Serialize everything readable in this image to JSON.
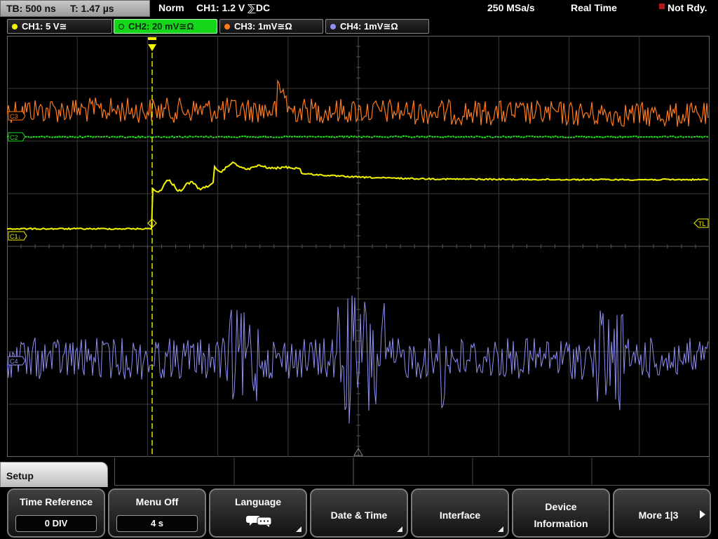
{
  "topbar": {
    "timebase": "TB: 500 ns",
    "trigger_time": "T: 1.47 µs",
    "trigger_mode": "Norm",
    "trigger_source": "CH1: 1.2 V ⅀DC",
    "sample_rate": "250 MSa/s",
    "acquisition": "Real Time",
    "status": "Not Rdy.",
    "status_color": "#b11a1a"
  },
  "channels": [
    {
      "label": "CH1: 5 V≅",
      "color": "#f4f400",
      "marker": "C1↓"
    },
    {
      "label": "CH2: 20 mV≅Ω",
      "color": "#22dd22",
      "marker": "C2"
    },
    {
      "label": "CH3: 1mV≅Ω",
      "color": "#ff7a1a",
      "marker": "C3"
    },
    {
      "label": "CH4: 1mV≅Ω",
      "color": "#8f8ff2",
      "marker": "C4"
    }
  ],
  "display": {
    "trigger_level_marker": "TL",
    "grid_color": "#3a3a3a"
  },
  "menu": {
    "title": "Setup",
    "softkeys": [
      {
        "label": "Time Reference",
        "value": "0 DIV"
      },
      {
        "label": "Menu Off",
        "value": "4 s"
      },
      {
        "label": "Language",
        "icon": "speech-bubbles-icon"
      },
      {
        "label": "Date & Time"
      },
      {
        "label": "Interface"
      },
      {
        "label_line1": "Device",
        "label_line2": "Information"
      },
      {
        "label": "More 1|3"
      }
    ]
  }
}
